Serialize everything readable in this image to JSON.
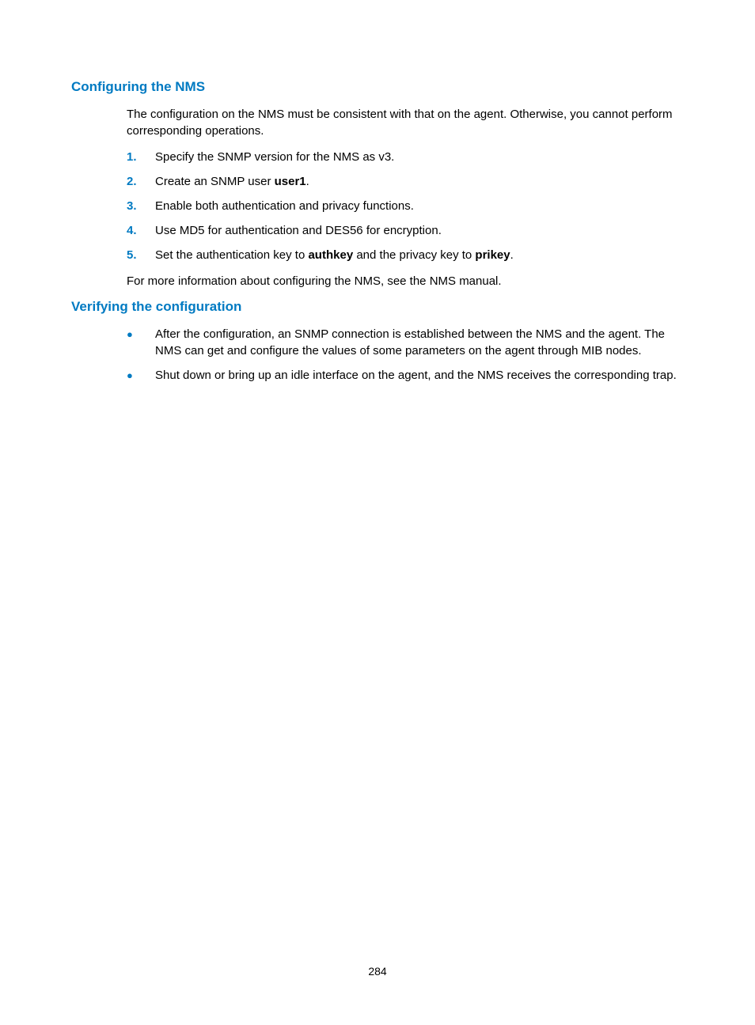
{
  "section1": {
    "heading": "Configuring the NMS",
    "intro": "The configuration on the NMS must be consistent with that on the agent. Otherwise, you cannot perform corresponding operations.",
    "steps": [
      {
        "num": "1.",
        "text": "Specify the SNMP version for the NMS as v3."
      },
      {
        "num": "2.",
        "prefix": "Create an SNMP user ",
        "bold": "user1",
        "suffix": "."
      },
      {
        "num": "3.",
        "text": "Enable both authentication and privacy functions."
      },
      {
        "num": "4.",
        "text": "Use MD5 for authentication and DES56 for encryption."
      },
      {
        "num": "5.",
        "prefix": "Set the authentication key to ",
        "bold": "authkey",
        "mid": " and the privacy key to ",
        "bold2": "prikey",
        "suffix": "."
      }
    ],
    "closing": "For more information about configuring the NMS, see the NMS manual."
  },
  "section2": {
    "heading": "Verifying the configuration",
    "bullets": [
      "After the configuration, an SNMP connection is established between the NMS and the agent. The NMS can get and configure the values of some parameters on the agent through MIB nodes.",
      "Shut down or bring up an idle interface on the agent, and the NMS receives the corresponding trap."
    ]
  },
  "pageNumber": "284"
}
